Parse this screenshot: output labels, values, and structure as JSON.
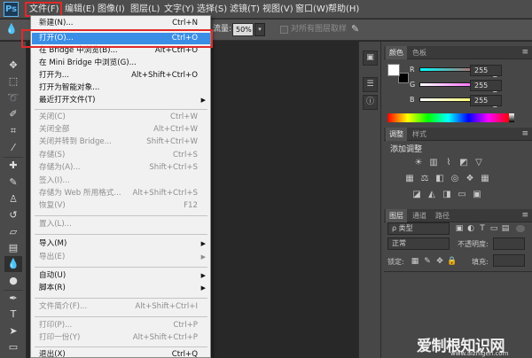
{
  "app": {
    "logo": "Ps"
  },
  "menubar": {
    "items": [
      "文件(F)",
      "编辑(E)",
      "图像(I)",
      "图层(L)",
      "文字(Y)",
      "选择(S)",
      "滤镜(T)",
      "视图(V)",
      "窗口(W)",
      "帮助(H)"
    ]
  },
  "options": {
    "flow_label": "流量:",
    "flow_value": "50%",
    "sample_all_layers": "对所有图层取样"
  },
  "file_menu": {
    "items": [
      {
        "label": "新建(N)...",
        "shortcut": "Ctrl+N"
      },
      {
        "label": "打开(O)...",
        "shortcut": "Ctrl+O"
      },
      {
        "label": "在 Bridge 中浏览(B)...",
        "shortcut": "Alt+Ctrl+O"
      },
      {
        "label": "在 Mini Bridge 中浏览(G)...",
        "shortcut": ""
      },
      {
        "label": "打开为...",
        "shortcut": "Alt+Shift+Ctrl+O"
      },
      {
        "label": "打开为智能对象...",
        "shortcut": ""
      },
      {
        "label": "最近打开文件(T)",
        "shortcut": ""
      },
      {
        "label": "关闭(C)",
        "shortcut": "Ctrl+W"
      },
      {
        "label": "关闭全部",
        "shortcut": "Alt+Ctrl+W"
      },
      {
        "label": "关闭并转到 Bridge...",
        "shortcut": "Shift+Ctrl+W"
      },
      {
        "label": "存储(S)",
        "shortcut": "Ctrl+S"
      },
      {
        "label": "存储为(A)...",
        "shortcut": "Shift+Ctrl+S"
      },
      {
        "label": "签入(I)...",
        "shortcut": ""
      },
      {
        "label": "存储为 Web 所用格式...",
        "shortcut": "Alt+Shift+Ctrl+S"
      },
      {
        "label": "恢复(V)",
        "shortcut": "F12"
      },
      {
        "label": "置入(L)...",
        "shortcut": ""
      },
      {
        "label": "导入(M)",
        "shortcut": ""
      },
      {
        "label": "导出(E)",
        "shortcut": ""
      },
      {
        "label": "自动(U)",
        "shortcut": ""
      },
      {
        "label": "脚本(R)",
        "shortcut": ""
      },
      {
        "label": "文件简介(F)...",
        "shortcut": "Alt+Shift+Ctrl+I"
      },
      {
        "label": "打印(P)...",
        "shortcut": "Ctrl+P"
      },
      {
        "label": "打印一份(Y)",
        "shortcut": "Alt+Shift+Ctrl+P"
      },
      {
        "label": "退出(X)",
        "shortcut": "Ctrl+Q"
      }
    ]
  },
  "color_panel": {
    "tabs": [
      "颜色",
      "色板"
    ],
    "r_label": "R",
    "r_value": "255",
    "g_label": "G",
    "g_value": "255",
    "b_label": "B",
    "b_value": "255"
  },
  "adjust_panel": {
    "tabs": [
      "调整",
      "样式"
    ],
    "title": "添加调整"
  },
  "layers_panel": {
    "tabs": [
      "图层",
      "通道",
      "路径"
    ],
    "filter_kind": "ρ 类型",
    "blend_mode": "正常",
    "opacity_label": "不透明度:",
    "lock_label": "锁定:",
    "fill_label": "填充:"
  },
  "watermark": {
    "text": "爱制根知识网",
    "url": "www.aizhigen.com"
  },
  "colors": {
    "menu_highlight": "#3a8ee6",
    "annotation_red": "#e02a2a",
    "r_slider": "#ff3030",
    "g_slider": "#ff30ff",
    "b_slider": "#ffff30"
  }
}
